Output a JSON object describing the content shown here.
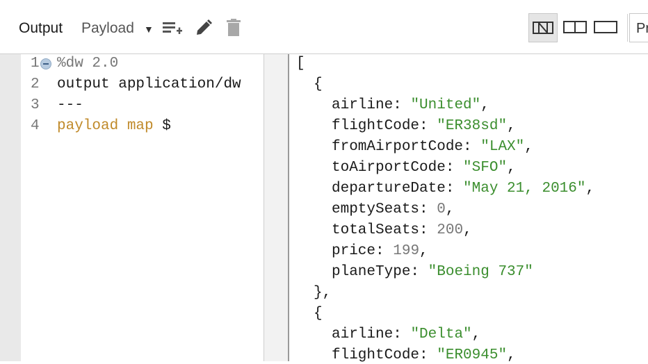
{
  "toolbar": {
    "output_label": "Output",
    "payload_label": "Payload",
    "preview_label": "Pr",
    "icons": [
      "add-list-icon",
      "pencil-icon",
      "trash-icon",
      "layout-single-icon",
      "layout-split-icon",
      "layout-full-icon",
      "caret-down-icon"
    ]
  },
  "script": {
    "lines": [
      {
        "num": "1",
        "text": "%dw 2.0"
      },
      {
        "num": "2",
        "text": "output application/dw"
      },
      {
        "num": "3",
        "text": "---"
      },
      {
        "num": "4",
        "text": "payload map $",
        "part1": "payload map",
        "part2": " $"
      }
    ]
  },
  "output": {
    "open_bracket": "[",
    "obj_open": "{",
    "obj_close": "},",
    "obj2_open": "{",
    "record1": [
      {
        "key": "airline",
        "value": "\"United\"",
        "type": "string"
      },
      {
        "key": "flightCode",
        "value": "\"ER38sd\"",
        "type": "string"
      },
      {
        "key": "fromAirportCode",
        "value": "\"LAX\"",
        "type": "string"
      },
      {
        "key": "toAirportCode",
        "value": "\"SFO\"",
        "type": "string"
      },
      {
        "key": "departureDate",
        "value": "\"May 21, 2016\"",
        "type": "string"
      },
      {
        "key": "emptySeats",
        "value": "0",
        "type": "number"
      },
      {
        "key": "totalSeats",
        "value": "200",
        "type": "number"
      },
      {
        "key": "price",
        "value": "199",
        "type": "number"
      },
      {
        "key": "planeType",
        "value": "\"Boeing 737\"",
        "type": "string",
        "last": true
      }
    ],
    "record2": [
      {
        "key": "airline",
        "value": "\"Delta\"",
        "type": "string"
      },
      {
        "key": "flightCode",
        "value": "\"ER0945\"",
        "type": "string"
      }
    ]
  },
  "colors": {
    "string": "#3b8e2e",
    "keyword": "#c08a2a",
    "number": "#777777"
  }
}
